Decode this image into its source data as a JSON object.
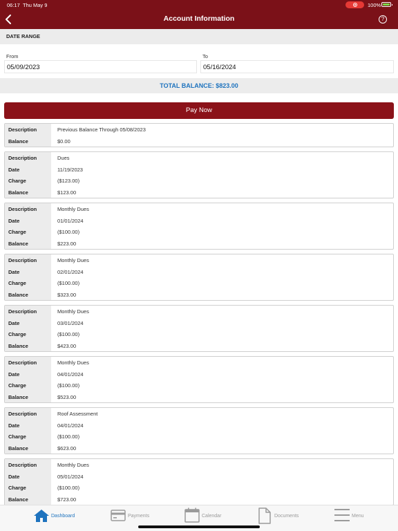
{
  "status": {
    "time": "06:17",
    "date": "Thu May 9",
    "battery": "100%"
  },
  "header": {
    "title": "Account Information",
    "help": "?"
  },
  "date_range": {
    "section_label": "DATE RANGE",
    "from_label": "From",
    "from_value": "05/09/2023",
    "to_label": "To",
    "to_value": "05/16/2024"
  },
  "total_balance": "TOTAL BALANCE: $823.00",
  "pay_button": "Pay Now",
  "cards": [
    {
      "rows": [
        {
          "label": "Description",
          "value": "Previous Balance Through 05/08/2023"
        },
        {
          "label": "Balance",
          "value": "$0.00"
        }
      ]
    },
    {
      "rows": [
        {
          "label": "Description",
          "value": "Dues"
        },
        {
          "label": "Date",
          "value": "11/19/2023"
        },
        {
          "label": "Charge",
          "value": "($123.00)"
        },
        {
          "label": "Balance",
          "value": "$123.00"
        }
      ]
    },
    {
      "rows": [
        {
          "label": "Description",
          "value": "Monthly Dues"
        },
        {
          "label": "Date",
          "value": "01/01/2024"
        },
        {
          "label": "Charge",
          "value": "($100.00)"
        },
        {
          "label": "Balance",
          "value": "$223.00"
        }
      ]
    },
    {
      "rows": [
        {
          "label": "Description",
          "value": "Monthly Dues"
        },
        {
          "label": "Date",
          "value": "02/01/2024"
        },
        {
          "label": "Charge",
          "value": "($100.00)"
        },
        {
          "label": "Balance",
          "value": "$323.00"
        }
      ]
    },
    {
      "rows": [
        {
          "label": "Description",
          "value": "Monthly Dues"
        },
        {
          "label": "Date",
          "value": "03/01/2024"
        },
        {
          "label": "Charge",
          "value": "($100.00)"
        },
        {
          "label": "Balance",
          "value": "$423.00"
        }
      ]
    },
    {
      "rows": [
        {
          "label": "Description",
          "value": "Monthly Dues"
        },
        {
          "label": "Date",
          "value": "04/01/2024"
        },
        {
          "label": "Charge",
          "value": "($100.00)"
        },
        {
          "label": "Balance",
          "value": "$523.00"
        }
      ]
    },
    {
      "rows": [
        {
          "label": "Description",
          "value": "Roof Assessment"
        },
        {
          "label": "Date",
          "value": "04/01/2024"
        },
        {
          "label": "Charge",
          "value": "($100.00)"
        },
        {
          "label": "Balance",
          "value": "$623.00"
        }
      ]
    },
    {
      "rows": [
        {
          "label": "Description",
          "value": "Monthly Dues"
        },
        {
          "label": "Date",
          "value": "05/01/2024"
        },
        {
          "label": "Charge",
          "value": "($100.00)"
        },
        {
          "label": "Balance",
          "value": "$723.00"
        }
      ]
    }
  ],
  "tabs": [
    {
      "label": "Dashboard",
      "icon": "home-icon"
    },
    {
      "label": "Payments",
      "icon": "card-icon"
    },
    {
      "label": "Calendar",
      "icon": "calendar-icon"
    },
    {
      "label": "Documents",
      "icon": "document-icon"
    },
    {
      "label": "Menu",
      "icon": "menu-icon"
    }
  ],
  "colors": {
    "brand": "#7b1118",
    "accent": "#1e73be"
  }
}
